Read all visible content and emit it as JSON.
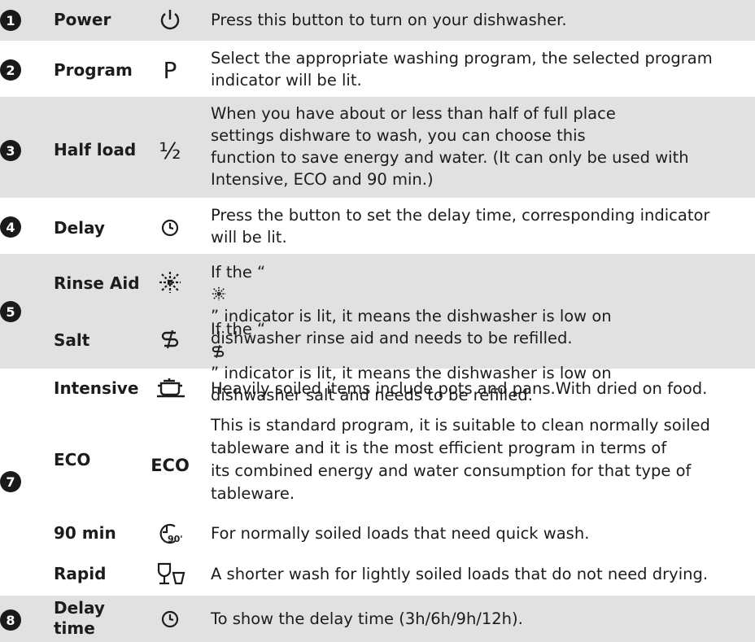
{
  "groups": [
    {
      "number": "1",
      "rows": [
        {
          "name": "Power",
          "icon": "power-icon",
          "lines": [
            "Press this button to turn on your dishwasher."
          ]
        }
      ]
    },
    {
      "number": "2",
      "rows": [
        {
          "name": "Program",
          "icon": "program-p-icon",
          "icon_text": "P",
          "lines": [
            "Select the appropriate washing program, the selected program",
            "indicator will be lit."
          ]
        }
      ]
    },
    {
      "number": "3",
      "rows": [
        {
          "name": "Half load",
          "icon": "half-load-icon",
          "icon_text": "½",
          "lines": [
            "When you have about or less than half of full place",
            "settings dishware to wash, you can choose this",
            "function to save energy and water. (It can only be used with",
            "Intensive, ECO and 90 min.)"
          ]
        }
      ]
    },
    {
      "number": "4",
      "rows": [
        {
          "name": "Delay",
          "icon": "clock-icon",
          "lines": [
            "Press the button to set the delay time, corresponding indicator",
            "will be lit."
          ]
        }
      ]
    },
    {
      "number": "5",
      "rows": [
        {
          "name": "Rinse Aid",
          "icon": "rinse-aid-icon",
          "line1_pre": "If the “ ",
          "line1_post": " ” indicator is lit, it means the dishwasher is low on",
          "line2": "dishwasher rinse aid and needs to be refilled."
        },
        {
          "name": "Salt",
          "icon": "salt-icon",
          "line1_pre": "If the “ ",
          "line1_post": " ” indicator is lit, it means the dishwasher is low on",
          "line2": "dishwasher salt and needs to be refilled."
        }
      ]
    },
    {
      "number": "7",
      "rows": [
        {
          "name": "Intensive",
          "icon": "pot-icon",
          "lines": [
            "Heavily soiled items include pots and pans.With dried on food."
          ]
        },
        {
          "name": "ECO",
          "icon": "eco-icon",
          "icon_text": "ECO",
          "lines": [
            "This is standard program, it is suitable to clean normally soiled",
            "tableware and it is the most efficient program in terms of",
            "its combined energy and water consumption for that type of",
            "tableware."
          ]
        },
        {
          "name": "90 min",
          "icon": "clock-90-icon",
          "icon_text": "90'",
          "lines": [
            "For normally soiled loads that need quick wash."
          ]
        },
        {
          "name": "Rapid",
          "icon": "glass-cup-icon",
          "lines": [
            "A shorter wash for lightly soiled loads that do not need drying."
          ]
        }
      ]
    },
    {
      "number": "8",
      "rows": [
        {
          "name_lines": [
            "Delay",
            "time"
          ],
          "icon": "clock-icon",
          "lines": [
            "To show the delay time (3h/6h/9h/12h)."
          ]
        }
      ]
    }
  ]
}
